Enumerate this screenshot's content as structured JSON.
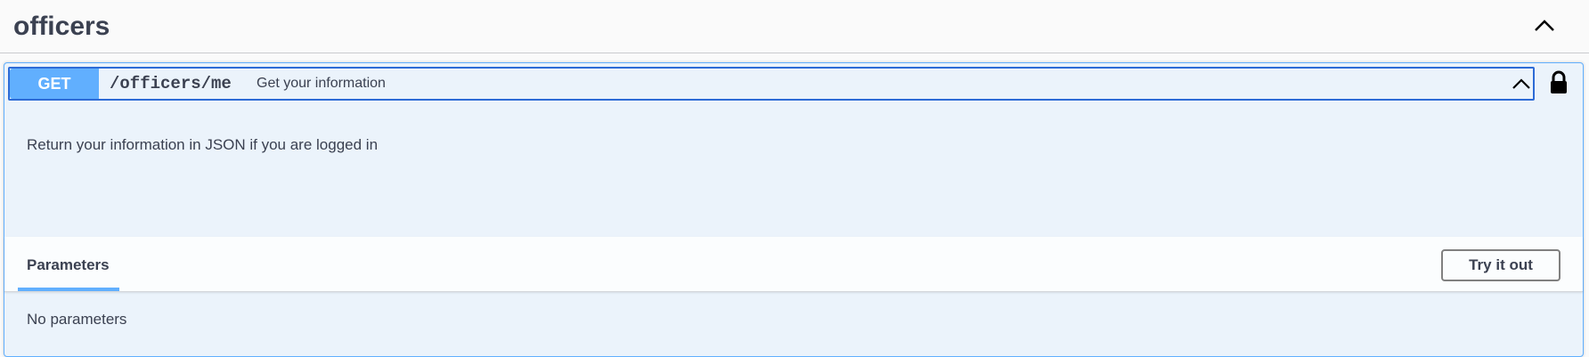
{
  "tag": {
    "title": "officers",
    "toggle_icon": "chevron-up-icon"
  },
  "operation": {
    "method": "GET",
    "path": "/officers/me",
    "summary": "Get your information",
    "description": "Return your information in JSON if you are logged in",
    "collapse_icon": "chevron-up-icon",
    "lock_icon": "lock-icon"
  },
  "parameters": {
    "tab_label": "Parameters",
    "try_button_label": "Try it out",
    "empty_text": "No parameters"
  },
  "colors": {
    "get_method": "#61affe",
    "opblock_bg": "#ebf3fb",
    "text": "#3b4151"
  }
}
